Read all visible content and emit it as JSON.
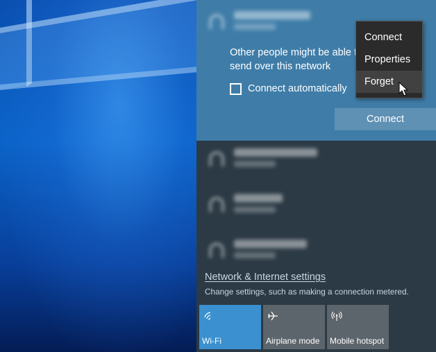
{
  "selected_network": {
    "warning_text": "Other people might be able t send over this network",
    "connect_automatically_label": "Connect automatically",
    "connect_automatically_checked": false,
    "connect_button_label": "Connect"
  },
  "context_menu": {
    "items": [
      {
        "label": "Connect"
      },
      {
        "label": "Properties"
      },
      {
        "label": "Forget"
      }
    ],
    "hovered": "Forget"
  },
  "settings": {
    "link_label": "Network & Internet settings",
    "description": "Change settings, such as making a connection metered."
  },
  "quick_actions": [
    {
      "label": "Wi-Fi",
      "icon": "wifi-icon",
      "active": true
    },
    {
      "label": "Airplane mode",
      "icon": "airplane-icon",
      "active": false
    },
    {
      "label": "Mobile hotspot",
      "icon": "hotspot-icon",
      "active": false
    }
  ],
  "colors": {
    "flyout_bg": "#2c3a45",
    "selected_bg": "#3f7da8",
    "accent": "#3b90cf"
  }
}
